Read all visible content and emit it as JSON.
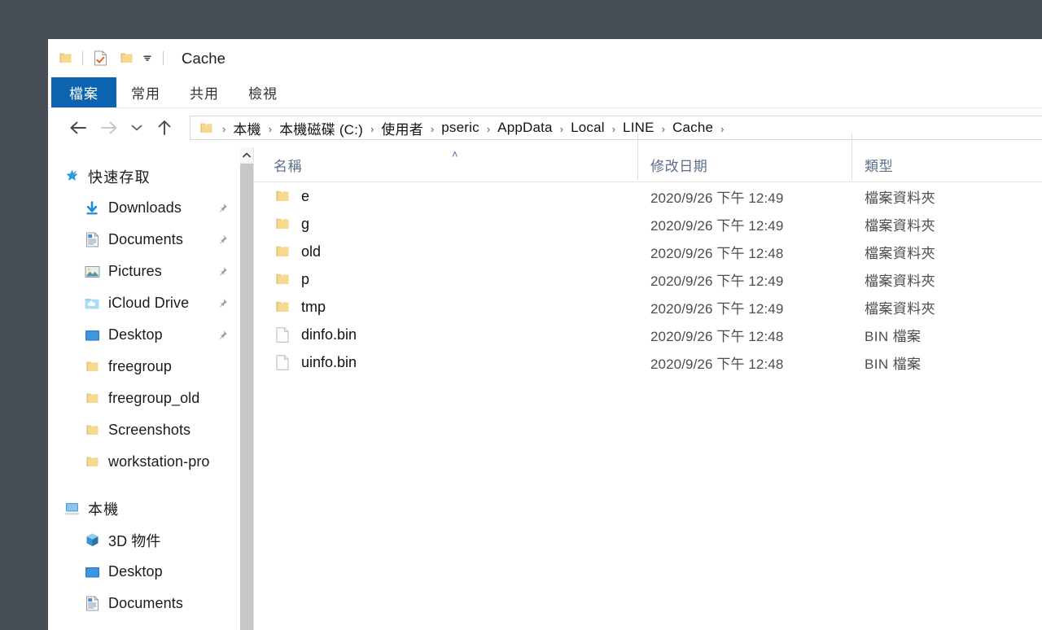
{
  "window": {
    "title": "Cache",
    "background_color": "#474e55",
    "accent_color": "#0c63b0"
  },
  "quick_access_toolbar": {
    "items": [
      {
        "name": "folder-icon",
        "label": ""
      },
      {
        "name": "properties-icon",
        "label": ""
      },
      {
        "name": "new-folder-icon",
        "label": ""
      },
      {
        "name": "customize-chevron-icon",
        "label": ""
      }
    ]
  },
  "ribbon": {
    "tabs": [
      {
        "label": "檔案",
        "active": true
      },
      {
        "label": "常用",
        "active": false
      },
      {
        "label": "共用",
        "active": false
      },
      {
        "label": "檢視",
        "active": false
      }
    ]
  },
  "navbar": {
    "back_tooltip": "上一頁",
    "forward_tooltip": "下一頁",
    "recent_tooltip": "最近的位置",
    "up_tooltip": "上移一層",
    "breadcrumbs": [
      "本機",
      "本機磁碟 (C:)",
      "使用者",
      "pseric",
      "AppData",
      "Local",
      "LINE",
      "Cache"
    ],
    "separator": "›"
  },
  "sidebar": {
    "sections": [
      {
        "label": "快速存取",
        "icon": "star-icon",
        "items": [
          {
            "label": "Downloads",
            "icon": "download-icon",
            "pinned": true
          },
          {
            "label": "Documents",
            "icon": "document-icon",
            "pinned": true
          },
          {
            "label": "Pictures",
            "icon": "pictures-icon",
            "pinned": true
          },
          {
            "label": "iCloud Drive",
            "icon": "icloud-icon",
            "pinned": true
          },
          {
            "label": "Desktop",
            "icon": "desktop-icon",
            "pinned": true
          },
          {
            "label": "freegroup",
            "icon": "folder-icon",
            "pinned": false
          },
          {
            "label": "freegroup_old",
            "icon": "folder-icon",
            "pinned": false
          },
          {
            "label": "Screenshots",
            "icon": "folder-icon",
            "pinned": false
          },
          {
            "label": "workstation-pro",
            "icon": "folder-icon",
            "pinned": false
          }
        ]
      },
      {
        "label": "本機",
        "icon": "this-pc-icon",
        "items": [
          {
            "label": "3D 物件",
            "icon": "3d-objects-icon",
            "pinned": false
          },
          {
            "label": "Desktop",
            "icon": "desktop-icon",
            "pinned": false
          },
          {
            "label": "Documents",
            "icon": "document-icon",
            "pinned": false
          }
        ]
      }
    ]
  },
  "file_list": {
    "sort_indicator": "˄",
    "columns": [
      {
        "label": "名稱"
      },
      {
        "label": "修改日期"
      },
      {
        "label": "類型"
      }
    ],
    "rows": [
      {
        "name": "e",
        "icon": "folder-icon",
        "date": "2020/9/26 下午 12:49",
        "type": "檔案資料夾"
      },
      {
        "name": "g",
        "icon": "folder-icon",
        "date": "2020/9/26 下午 12:49",
        "type": "檔案資料夾"
      },
      {
        "name": "old",
        "icon": "folder-icon",
        "date": "2020/9/26 下午 12:48",
        "type": "檔案資料夾"
      },
      {
        "name": "p",
        "icon": "folder-icon",
        "date": "2020/9/26 下午 12:49",
        "type": "檔案資料夾"
      },
      {
        "name": "tmp",
        "icon": "folder-icon",
        "date": "2020/9/26 下午 12:49",
        "type": "檔案資料夾"
      },
      {
        "name": "dinfo.bin",
        "icon": "file-icon",
        "date": "2020/9/26 下午 12:48",
        "type": "BIN 檔案"
      },
      {
        "name": "uinfo.bin",
        "icon": "file-icon",
        "date": "2020/9/26 下午 12:48",
        "type": "BIN 檔案"
      }
    ]
  }
}
